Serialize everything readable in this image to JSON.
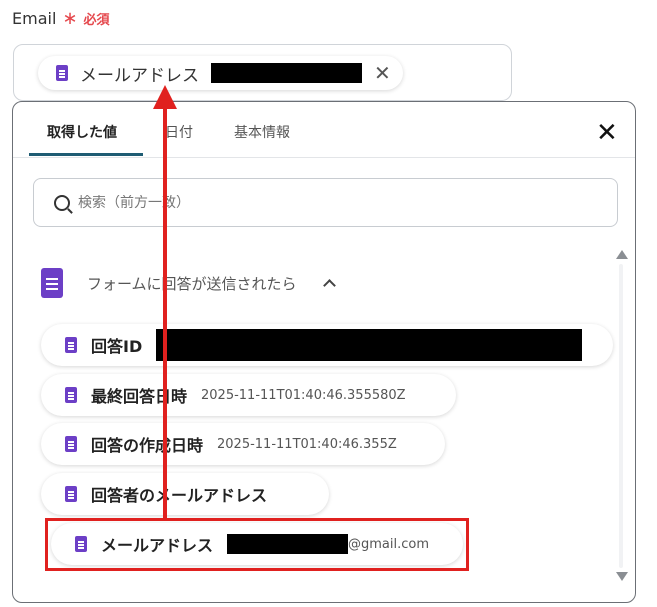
{
  "field": {
    "label": "Email",
    "required_mark": "∗",
    "required_text": "必須",
    "selected_chip": {
      "label": "メールアドレス",
      "close": "✕"
    }
  },
  "panel": {
    "tabs": [
      {
        "label": "取得した値",
        "active": true
      },
      {
        "label": "日付",
        "active": false
      },
      {
        "label": "基本情報",
        "active": false
      }
    ],
    "close": "✕",
    "search": {
      "placeholder": "検索（前方一致）",
      "value": ""
    },
    "section": {
      "title": "フォームに回答が送信されたら"
    },
    "items": [
      {
        "label": "回答ID",
        "value": ""
      },
      {
        "label": "最終回答日時",
        "value": "2025-11-11T01:40:46.355580Z"
      },
      {
        "label": "回答の作成日時",
        "value": "2025-11-11T01:40:46.355Z"
      },
      {
        "label": "回答者のメールアドレス",
        "value": ""
      },
      {
        "label": "メールアドレス",
        "value": "@gmail.com"
      }
    ]
  },
  "colors": {
    "accent": "#1e5c73",
    "icon": "#6c3fc6",
    "annotation": "#e0211f",
    "required": "#e5484d"
  }
}
